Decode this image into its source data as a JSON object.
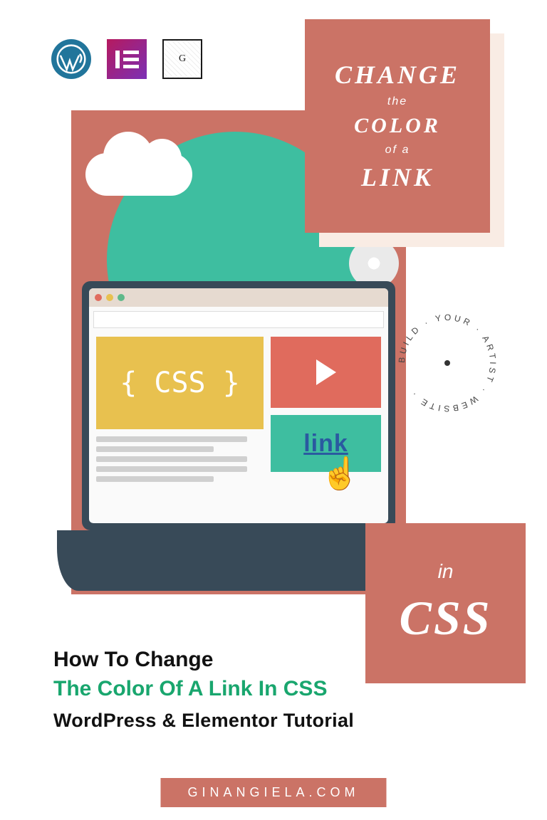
{
  "icons": {
    "wordpress": "W",
    "elementor": "E",
    "ginangiela": "G"
  },
  "panel_top": {
    "line1": "CHANGE",
    "line2": "the",
    "line3": "COLOR",
    "line4": "of a",
    "line5": "LINK"
  },
  "illustration": {
    "css_label": "{ CSS }",
    "link_label": "link"
  },
  "circular_text": "BUILD · YOUR · ARTIST · WEBSITE ·",
  "panel_bottom": {
    "line1": "in",
    "line2": "CSS"
  },
  "article": {
    "line1": "How To Change",
    "line2": "The Color Of A Link In CSS",
    "line3": "WordPress & Elementor Tutorial"
  },
  "footer": "GINANGIELA.COM",
  "colors": {
    "terracotta": "#cb7366",
    "teal": "#3ebea0",
    "green_text": "#19a66e"
  }
}
